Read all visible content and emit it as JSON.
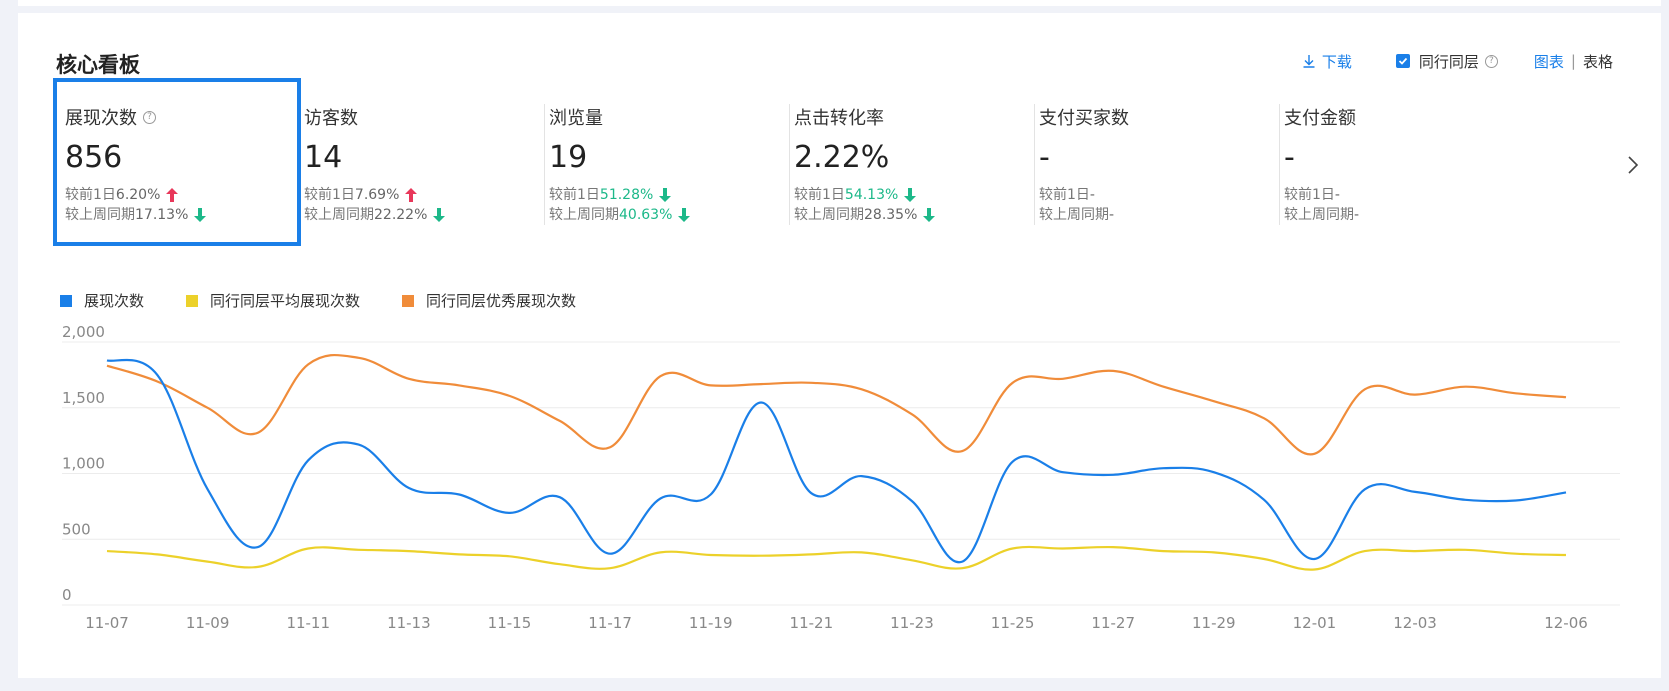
{
  "header": {
    "title": "核心看板",
    "download_label": "下载",
    "peer_label": "同行同层",
    "view_chart": "图表",
    "view_divider": "|",
    "view_table": "表格"
  },
  "metrics": [
    {
      "name": "展现次数",
      "has_help": true,
      "value": "856",
      "day_label": "较前1日",
      "day_value": "6.20%",
      "day_dir": "up",
      "week_label": "较上周同期",
      "week_value": "17.13%",
      "week_dir": "down"
    },
    {
      "name": "访客数",
      "value": "14",
      "day_label": "较前1日",
      "day_value": "7.69%",
      "day_dir": "up",
      "week_label": "较上周同期",
      "week_value": "22.22%",
      "week_dir": "down"
    },
    {
      "name": "浏览量",
      "value": "19",
      "day_label": "较前1日",
      "day_value": "51.28%",
      "day_dir": "down",
      "week_label": "较上周同期",
      "week_value": "40.63%",
      "week_dir": "down"
    },
    {
      "name": "点击转化率",
      "value": "2.22%",
      "day_label": "较前1日",
      "day_value": "54.13%",
      "day_dir": "down",
      "week_label": "较上周同期",
      "week_value": "28.35%",
      "week_dir": "down"
    },
    {
      "name": "支付买家数",
      "value": "-",
      "day_label": "较前1日",
      "day_value": "-",
      "day_dir": "none",
      "week_label": "较上周同期",
      "week_value": "-",
      "week_dir": "none"
    },
    {
      "name": "支付金额",
      "value": "-",
      "day_label": "较前1日",
      "day_value": "-",
      "day_dir": "none",
      "week_label": "较上周同期",
      "week_value": "-",
      "week_dir": "none"
    }
  ],
  "colors": {
    "accent": "#1a7fe8",
    "up": "#e8375a",
    "down": "#1cb889",
    "series_blue": "#1a7fe8",
    "series_yellow": "#ecd12a",
    "series_orange": "#f08c3a"
  },
  "chart_data": {
    "type": "line",
    "ylim": [
      0,
      2000
    ],
    "yticks": [
      "2,000",
      "1,500",
      "1,000",
      "500",
      "0"
    ],
    "ytick_values": [
      2000,
      1500,
      1000,
      500,
      0
    ],
    "x": [
      "11-07",
      "11-08",
      "11-09",
      "11-10",
      "11-11",
      "11-12",
      "11-13",
      "11-14",
      "11-15",
      "11-16",
      "11-17",
      "11-18",
      "11-19",
      "11-20",
      "11-21",
      "11-22",
      "11-23",
      "11-24",
      "11-25",
      "11-26",
      "11-27",
      "11-28",
      "11-29",
      "11-30",
      "12-01",
      "12-02",
      "12-03",
      "12-04",
      "12-05",
      "12-06"
    ],
    "xticks": [
      "11-07",
      "11-09",
      "11-11",
      "11-13",
      "11-15",
      "11-17",
      "11-19",
      "11-21",
      "11-23",
      "11-25",
      "11-27",
      "11-29",
      "12-01",
      "12-03",
      "12-06"
    ],
    "series": [
      {
        "name": "展现次数",
        "color": "#1a7fe8",
        "values": [
          1860,
          1750,
          880,
          440,
          1100,
          1220,
          890,
          840,
          700,
          820,
          390,
          810,
          840,
          1540,
          850,
          980,
          790,
          330,
          1090,
          1010,
          990,
          1040,
          1010,
          800,
          350,
          880,
          860,
          800,
          795,
          856
        ]
      },
      {
        "name": "同行同层平均展现次数",
        "color": "#ecd12a",
        "values": [
          410,
          385,
          330,
          290,
          430,
          420,
          410,
          385,
          370,
          310,
          280,
          400,
          380,
          375,
          385,
          400,
          340,
          280,
          430,
          430,
          440,
          410,
          400,
          350,
          270,
          410,
          410,
          420,
          390,
          380
        ]
      },
      {
        "name": "同行同层优秀展现次数",
        "color": "#f08c3a",
        "values": [
          1820,
          1700,
          1500,
          1310,
          1830,
          1880,
          1720,
          1670,
          1590,
          1400,
          1200,
          1740,
          1670,
          1680,
          1690,
          1640,
          1450,
          1170,
          1690,
          1720,
          1780,
          1660,
          1550,
          1420,
          1150,
          1640,
          1600,
          1660,
          1610,
          1580
        ]
      }
    ]
  }
}
